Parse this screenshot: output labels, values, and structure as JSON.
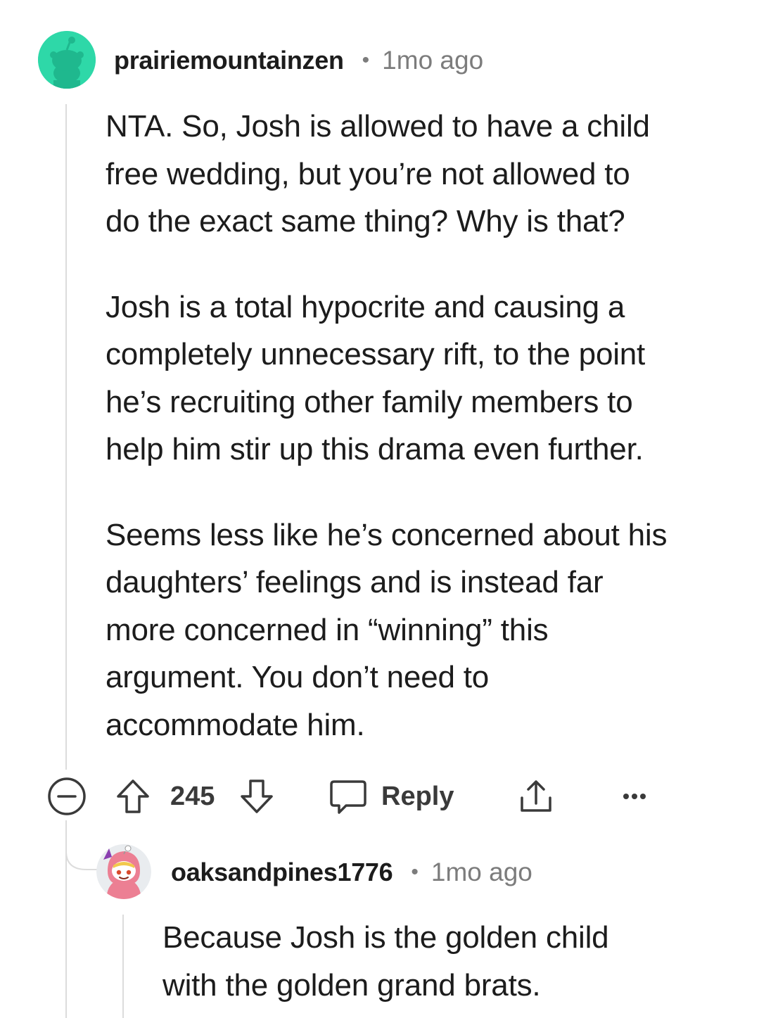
{
  "comment": {
    "username": "prairiemountainzen",
    "separator": "•",
    "time": "1mo ago",
    "paragraphs": [
      [
        "NTA. So, Josh is allowed to have a child",
        "free wedding, but you’re not allowed to",
        "do the exact same thing? Why is that?"
      ],
      [
        "Josh is a total hypocrite and causing a",
        "completely unnecessary rift, to the point",
        "he’s recruiting other family members to",
        "help him stir up this drama even further."
      ],
      [
        "Seems less like he’s concerned about his",
        "daughters’ feelings and is instead far",
        "more concerned in “winning” this",
        "argument. You don’t need to",
        "accommodate him."
      ]
    ],
    "avatar_icon": "snoo-avatar-icon",
    "avatar_color": "#2ed8a8"
  },
  "actions": {
    "collapse_icon": "collapse-minus-icon",
    "upvote_icon": "upvote-arrow-icon",
    "vote_count": "245",
    "downvote_icon": "downvote-arrow-icon",
    "reply_icon": "comment-bubble-icon",
    "reply_label": "Reply",
    "share_icon": "share-icon",
    "more_icon": "more-dots-icon",
    "more_label": "•••"
  },
  "reply": {
    "username": "oaksandpines1776",
    "separator": "•",
    "time": "1mo ago",
    "paragraphs": [
      [
        "Because Josh is the golden child",
        "with the golden grand brats."
      ]
    ],
    "avatar_icon": "snoo-pink-hood-avatar-icon"
  },
  "colors": {
    "text": "#1c1c1c",
    "meta": "#7c7c7c",
    "thread_line": "#dcdcdc",
    "icon": "#3a3a3a"
  }
}
